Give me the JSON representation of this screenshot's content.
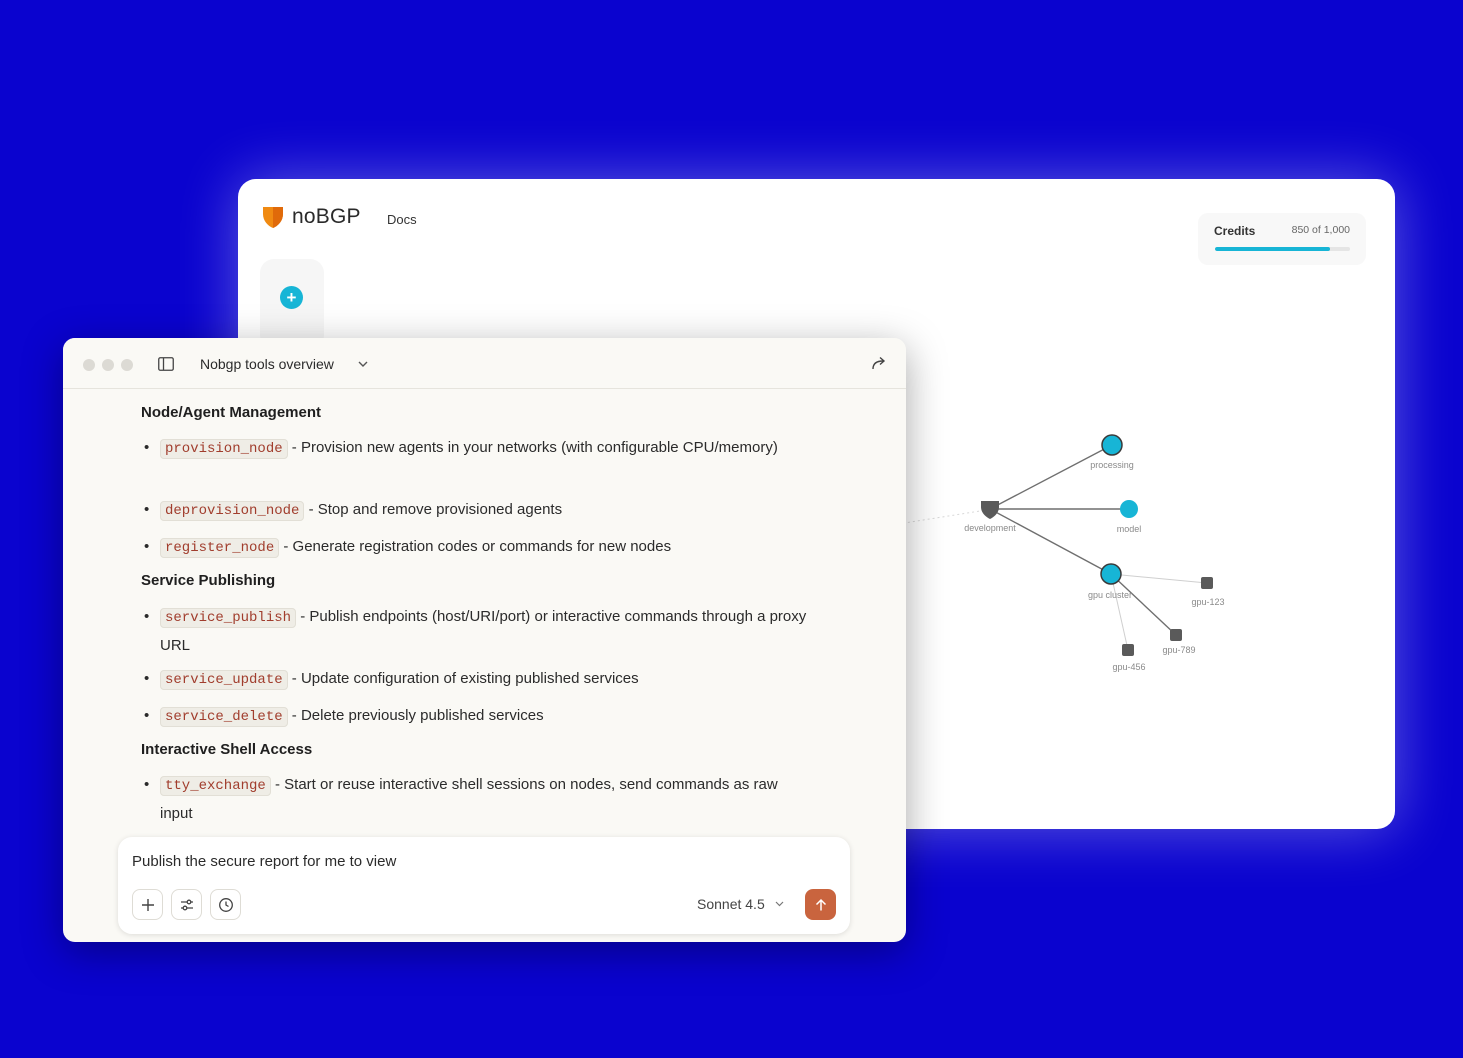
{
  "background_color": "#0a03cf",
  "app": {
    "brand_name": "noBGP",
    "nav_docs": "Docs",
    "add_button_glyph": "+",
    "credits": {
      "label": "Credits",
      "value_text": "850 of 1,000",
      "used": 850,
      "total": 1000
    },
    "graph": {
      "nodes": [
        {
          "id": "development",
          "label": "development",
          "kind": "shield"
        },
        {
          "id": "processing",
          "label": "processing",
          "kind": "circle-outlined"
        },
        {
          "id": "model",
          "label": "model",
          "kind": "circle"
        },
        {
          "id": "gpu-cluster",
          "label": "gpu cluster",
          "kind": "circle-outlined"
        },
        {
          "id": "gpu-123",
          "label": "gpu-123",
          "kind": "square"
        },
        {
          "id": "gpu-789",
          "label": "gpu-789",
          "kind": "square"
        },
        {
          "id": "gpu-456",
          "label": "gpu-456",
          "kind": "square"
        }
      ],
      "edges": [
        [
          "development",
          "processing"
        ],
        [
          "development",
          "model"
        ],
        [
          "development",
          "gpu-cluster"
        ],
        [
          "gpu-cluster",
          "gpu-123"
        ],
        [
          "gpu-cluster",
          "gpu-789"
        ],
        [
          "gpu-cluster",
          "gpu-456"
        ]
      ],
      "accent_color": "#17b5d6",
      "node_color": "#5a5a5a"
    }
  },
  "chat": {
    "title": "Nobgp tools overview",
    "sections": [
      {
        "heading": "Node/Agent Management",
        "items": [
          {
            "code": "provision_node",
            "text": " - Provision new agents in your networks (with configurable CPU/memory)"
          },
          {
            "code": "deprovision_node",
            "text": " - Stop and remove provisioned agents"
          },
          {
            "code": "register_node",
            "text": " - Generate registration codes or commands for new nodes"
          }
        ]
      },
      {
        "heading": "Service Publishing",
        "items": [
          {
            "code": "service_publish",
            "text": " - Publish endpoints (host/URI/port) or interactive commands through a proxy URL"
          },
          {
            "code": "service_update",
            "text": " - Update configuration of existing published services"
          },
          {
            "code": "service_delete",
            "text": " - Delete previously published services"
          }
        ]
      },
      {
        "heading": "Interactive Shell Access",
        "items": [
          {
            "code": "tty_exchange",
            "text": " - Start or reuse interactive shell sessions on nodes, send commands as raw input"
          }
        ]
      }
    ],
    "composer": {
      "input_value": "Publish the secure report for me to view",
      "model_label": "Sonnet 4.5",
      "send_color": "#c9643e"
    }
  }
}
